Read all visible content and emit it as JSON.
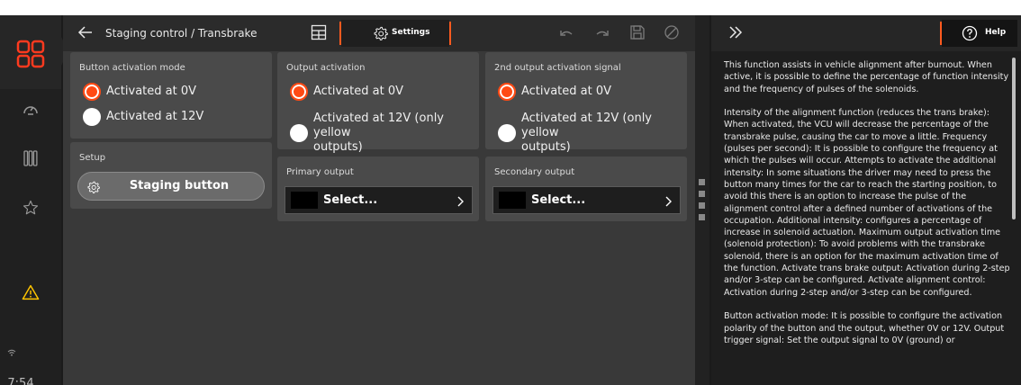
{
  "window": {
    "title": "Staging control / Transbrake"
  },
  "toolbar": {
    "settings_label": "Settings"
  },
  "rail": {
    "time": "7:54"
  },
  "cards": {
    "button_activation": {
      "title": "Button activation mode",
      "options": [
        {
          "label": "Activated at 0V",
          "selected": true
        },
        {
          "label": "Activated at 12V",
          "selected": false
        }
      ]
    },
    "output_activation": {
      "title": "Output activation",
      "options": [
        {
          "label": "Activated at 0V",
          "selected": true
        },
        {
          "label_line1": "Activated at 12V (only yellow",
          "label_line2": "outputs)",
          "selected": false
        }
      ]
    },
    "second_output_activation": {
      "title": "2nd output activation signal",
      "options": [
        {
          "label": "Activated at 0V",
          "selected": true
        },
        {
          "label_line1": "Activated at 12V (only yellow",
          "label_line2": "outputs)",
          "selected": false
        }
      ]
    },
    "setup": {
      "title": "Setup",
      "button_label": "Staging button"
    },
    "primary_output": {
      "title": "Primary output",
      "select_label": "Select..."
    },
    "secondary_output": {
      "title": "Secondary output",
      "select_label": "Select..."
    }
  },
  "help": {
    "button_label": "Help",
    "paragraphs": [
      "This function assists in vehicle alignment after burnout. When active, it is possible to define the percentage of function intensity and the frequency of pulses of the solenoids.",
      "Intensity of the alignment function (reduces the trans brake): When activated, the VCU will decrease the percentage of the transbrake pulse, causing the car to move a little. Frequency (pulses per second): It is possible to configure the frequency at which the pulses will occur. Attempts to activate the additional intensity: In some situations the driver may need to press the button many times for the car to reach the starting position, to avoid this there is an option to increase the pulse of the alignment control after a defined number of activations of the occupation. Additional intensity: configures a percentage of increase in solenoid actuation. Maximum output activation time (solenoid protection): To avoid problems with the transbrake solenoid, there is an option for the maximum activation time of the function. Activate trans brake output: Activation during 2-step and/or 3-step can be configured. Activate alignment control: Activation during 2-step and/or 3-step can be configured.",
      "Button activation mode: It is possible to configure the activation polarity of the button and the output, whether 0V or 12V. Output trigger signal: Set the output signal to 0V (ground) or"
    ]
  },
  "colors": {
    "accent": "#ff5a1f",
    "radio_on": "#ff4a14",
    "warning": "#ffc400",
    "home_icon": "#ff3a1f"
  }
}
